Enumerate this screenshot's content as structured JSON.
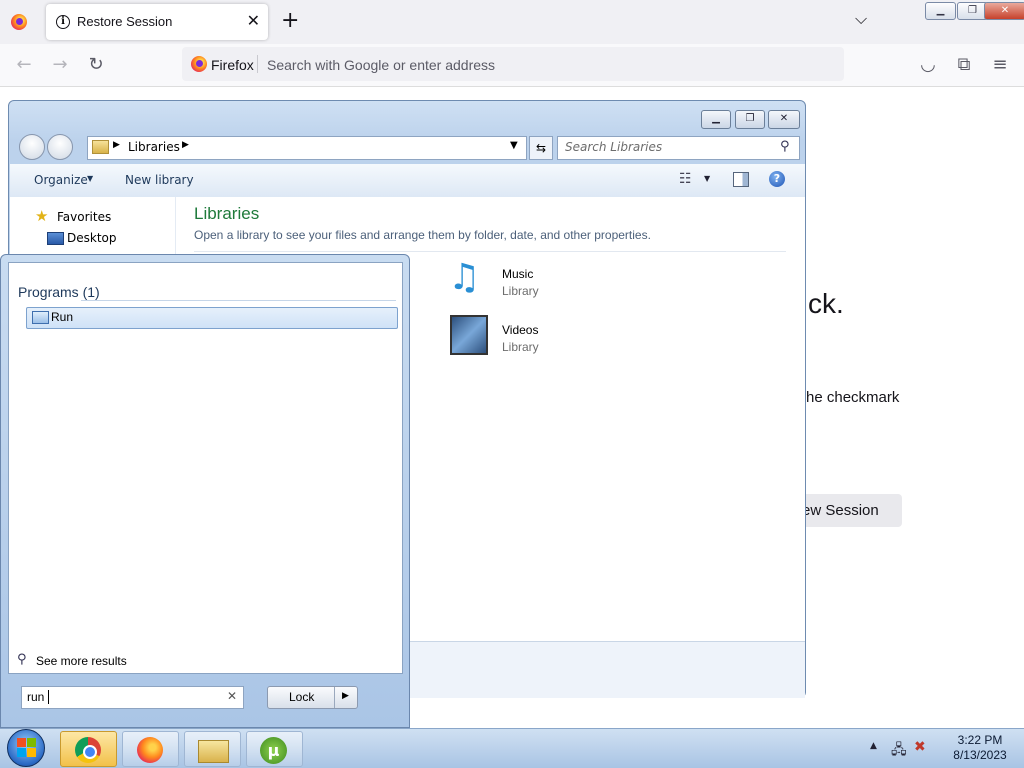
{
  "firefox": {
    "tab_title": "Restore Session",
    "url_brand": "Firefox",
    "url_placeholder": "Search with Google or enter address",
    "page_heading_fragment": "ck.",
    "page_text_fragment": "he checkmark",
    "page_button_fragment": "ew Session"
  },
  "explorer": {
    "breadcrumb": "Libraries",
    "search_placeholder": "Search Libraries",
    "toolbar": {
      "organize": "Organize",
      "new_library": "New library"
    },
    "nav": {
      "favorites": "Favorites",
      "desktop": "Desktop"
    },
    "heading": "Libraries",
    "subtitle": "Open a library to see your files and arrange them by folder, date, and other properties.",
    "libraries": [
      {
        "name": "Music",
        "type": "Library"
      },
      {
        "name": "Videos",
        "type": "Library"
      }
    ]
  },
  "startmenu": {
    "group": "Programs (1)",
    "result": "Run",
    "see_more": "See more results",
    "search_value": "run",
    "lock_label": "Lock"
  },
  "taskbar": {
    "time": "3:22 PM",
    "date": "8/13/2023",
    "apps": [
      "chrome-icon",
      "firefox-icon",
      "explorer-icon",
      "utorrent-icon"
    ]
  },
  "colors": {
    "accent": "#1e7a3a",
    "highlight": "#cfe2f7"
  }
}
